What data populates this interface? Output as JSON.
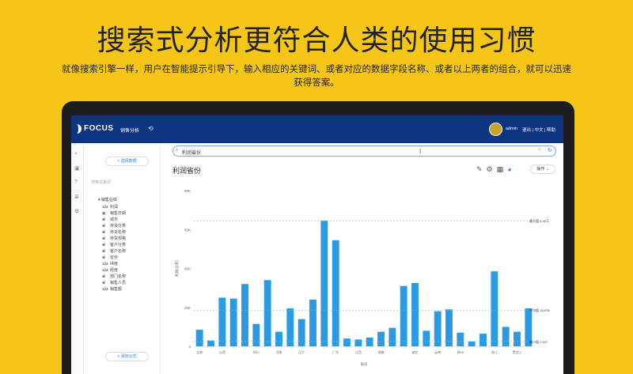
{
  "headline": "搜索式分析更符合人类的使用习惯",
  "subtitle_line1": "就像搜索引擎一样，用户在智能提示引导下，输入相应的关键词、或者对应的数据字段名称、或者以上两者的组合，就可以迅速",
  "subtitle_line2": "获得答案。",
  "app": {
    "logo_text": "FOCUS",
    "nav_item": "销售分析",
    "user": "admin",
    "top_links": "退出  |  中文  |  帮助"
  },
  "sidebar": {
    "select_button": "< 选择数据",
    "search_placeholder": "搜索关键词",
    "root_label": "▾ 销售业绩",
    "fields": [
      {
        "type": "123",
        "name": "利润"
      },
      {
        "type": "▦",
        "name": "销售日期"
      },
      {
        "type": "∉",
        "name": "城市"
      },
      {
        "type": "∉",
        "name": "存货分类"
      },
      {
        "type": "∉",
        "name": "存货名称"
      },
      {
        "type": "∉",
        "name": "存货规格"
      },
      {
        "type": "∉",
        "name": "客户分类"
      },
      {
        "type": "∉",
        "name": "客户名称"
      },
      {
        "type": "∉",
        "name": "省份"
      },
      {
        "type": "123",
        "name": "纬度"
      },
      {
        "type": "123",
        "name": "经度"
      },
      {
        "type": "∉",
        "name": "部门名称"
      },
      {
        "type": "∉",
        "name": "销售人员"
      },
      {
        "type": "123",
        "name": "销售额"
      }
    ],
    "add_button": "+ 添加公式"
  },
  "search": {
    "query": "利润省份"
  },
  "panel": {
    "title": "利润省份",
    "ops_button": "操作 ⌄"
  },
  "chart_data": {
    "type": "bar",
    "title": "",
    "xlabel": "省份",
    "ylabel": "利润(总和)",
    "ylim": [
      0,
      80000
    ],
    "yticks": [
      "0",
      "20K",
      "40K",
      "60K",
      "80K"
    ],
    "tick_labels": [
      "吉林",
      "山西",
      "四川",
      "河南",
      "辽宁",
      "广东",
      "江西",
      "湖南",
      "湖北",
      "云南",
      "贵州",
      "浙江",
      "黑龙江"
    ],
    "values": [
      8500,
      3000,
      25000,
      24500,
      32000,
      11500,
      34000,
      7500,
      19500,
      14000,
      24000,
      64500,
      54500,
      4000,
      3500,
      4500,
      7500,
      9500,
      31000,
      32500,
      8000,
      18000,
      19000,
      7000,
      2500,
      6500,
      38500,
      10000,
      7500,
      19500
    ],
    "ref_lines": [
      {
        "value": 64500,
        "label": "最大值 6.45万"
      },
      {
        "value": 18600,
        "label": "平均值 18,678"
      },
      {
        "value": 2500,
        "label": "最小值 2,547"
      }
    ],
    "bar_color": "#2A9BE3"
  }
}
